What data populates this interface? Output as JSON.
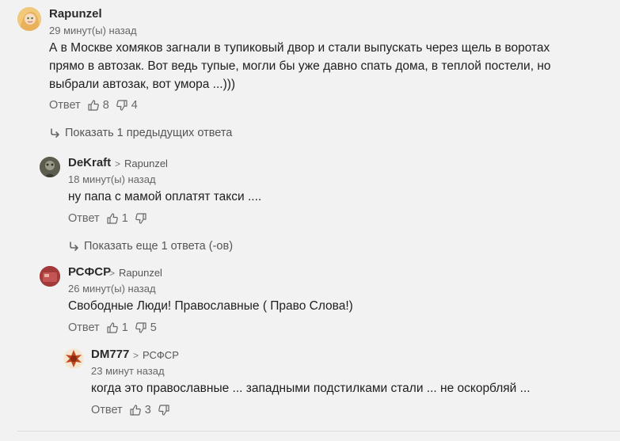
{
  "comments": [
    {
      "author": "Rapunzel",
      "time": "29 минут(ы) назад",
      "text": "А в Москве хомяков загнали в тупиковый двор и стали выпускать через щель в воротах прямо в автозак. Вот ведь тупые, могли бы уже давно спать дома, в теплой постели, но выбрали автозак, вот умора ...)))",
      "reply_label": "Ответ",
      "likes": "8",
      "dislikes": "4"
    },
    {
      "author": "DeKraft",
      "reply_to": "Rapunzel",
      "time": "18 минут(ы) назад",
      "text": "ну папа с мамой оплатят такси ....",
      "reply_label": "Ответ",
      "likes": "1",
      "dislikes": ""
    },
    {
      "author": "РСФСР",
      "reply_to": "Rapunzel",
      "time": "26 минут(ы) назад",
      "text": "Свободные Люди! Православные ( Право Слова!)",
      "reply_label": "Ответ",
      "likes": "1",
      "dislikes": "5"
    },
    {
      "author": "DM777",
      "reply_to": "РСФСР",
      "time": "23 минут назад",
      "text": "когда это православные ... западными подстилками стали ... не оскорбляй ...",
      "reply_label": "Ответ",
      "likes": "3",
      "dislikes": ""
    }
  ],
  "show_previous": "Показать 1 предыдущих ответа",
  "show_more": "Показать еще 1 ответа (-ов)",
  "icons": {
    "like": "thumb-up-icon",
    "dislike": "thumb-down-icon",
    "reply_arrow": "reply-arrow-icon",
    "chevron": "chevron-right-icon"
  }
}
